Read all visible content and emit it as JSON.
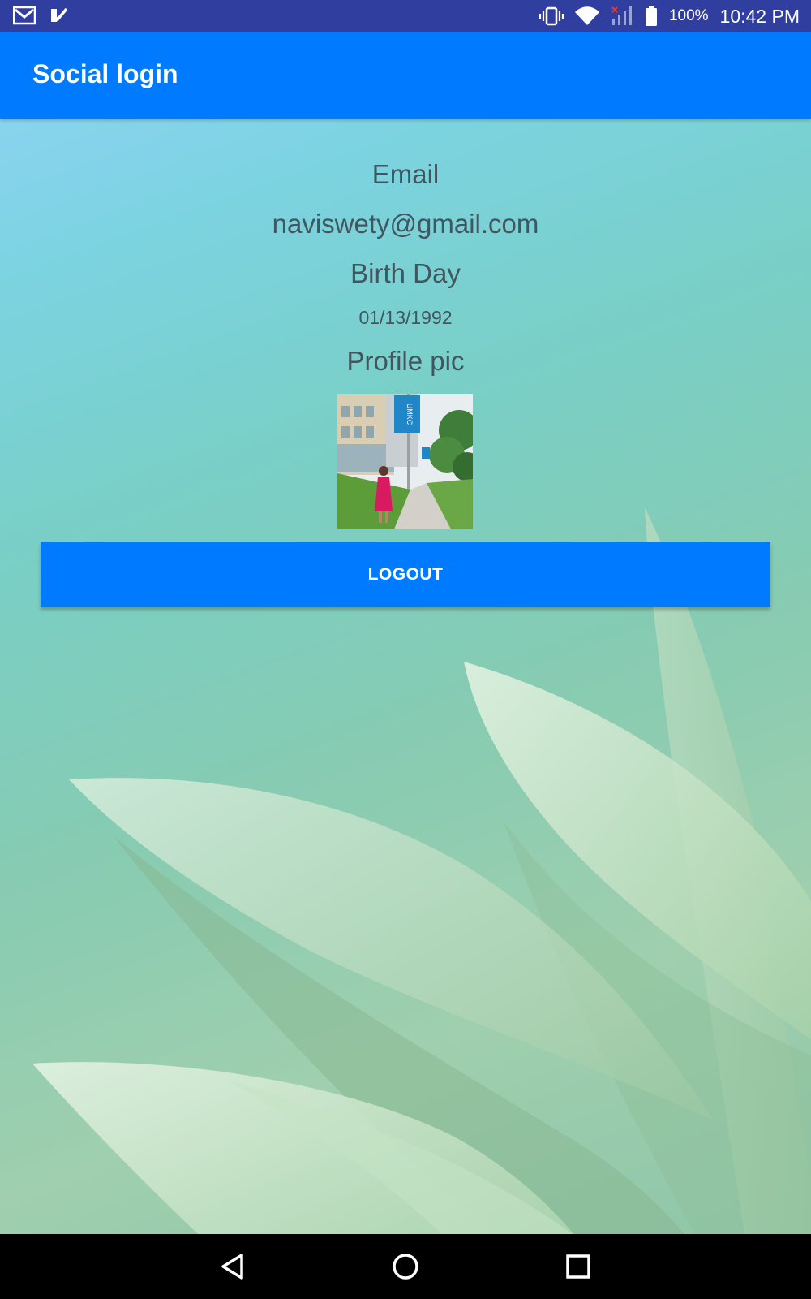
{
  "status_bar": {
    "battery": "100%",
    "time": "10:42 PM",
    "icons_left": [
      "gmail-icon",
      "check-notification-icon"
    ],
    "icons_right": [
      "vibrate-icon",
      "wifi-icon",
      "signal-icon",
      "battery-icon"
    ]
  },
  "app_bar": {
    "title": "Social login",
    "color": "#007bff"
  },
  "profile": {
    "email_label": "Email",
    "email_value": "naviswety@gmail.com",
    "birthday_label": "Birth Day",
    "birthday_value": "01/13/1992",
    "profile_pic_label": "Profile pic",
    "profile_pic_banner": "UMKC"
  },
  "actions": {
    "logout_label": "LOGOUT"
  },
  "nav_bar": {
    "buttons": [
      "back-icon",
      "home-icon",
      "recents-icon"
    ]
  }
}
